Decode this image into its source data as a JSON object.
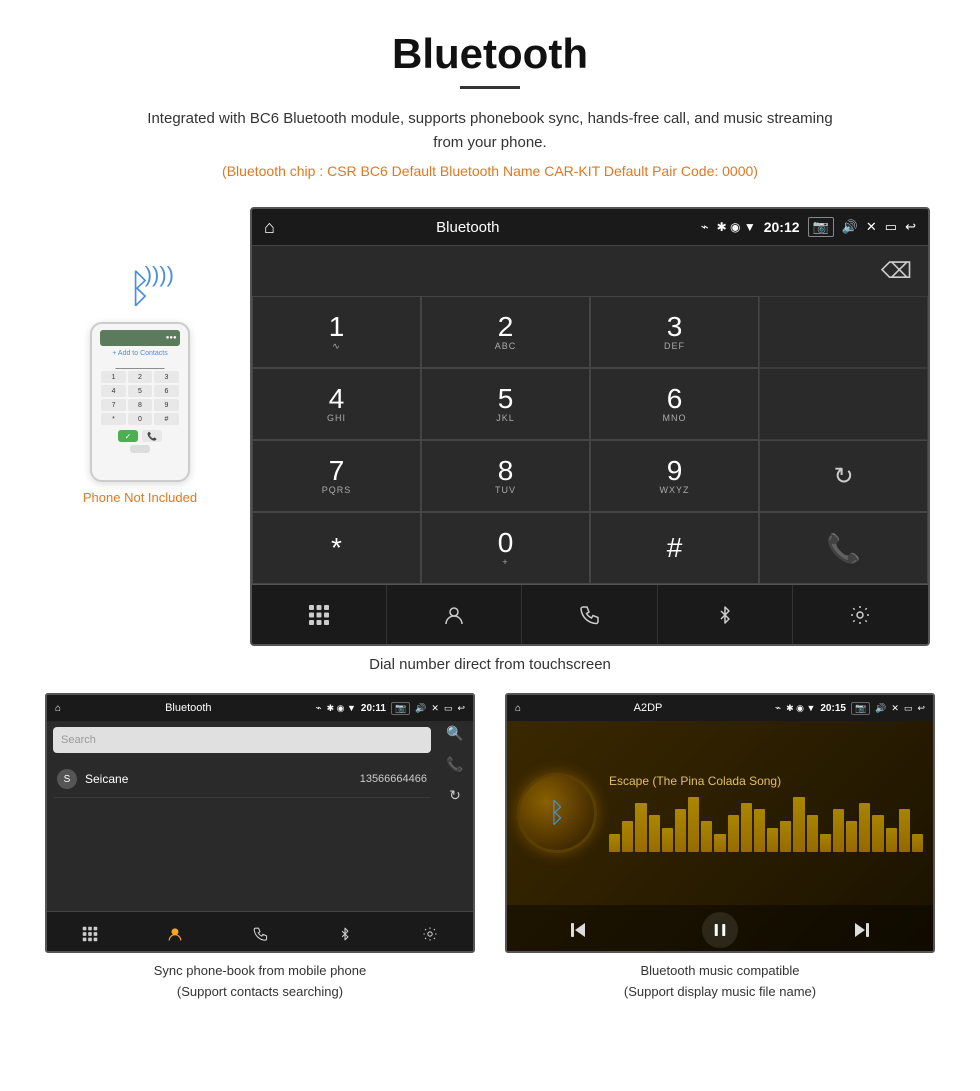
{
  "header": {
    "title": "Bluetooth",
    "subtitle": "Integrated with BC6 Bluetooth module, supports phonebook sync, hands-free call, and music streaming from your phone.",
    "specs": "(Bluetooth chip : CSR BC6    Default Bluetooth Name CAR-KIT    Default Pair Code: 0000)"
  },
  "phone_note": "Phone Not Included",
  "main_screen": {
    "statusbar": {
      "home_icon": "⌂",
      "title": "Bluetooth",
      "usb_icon": "⌁",
      "time": "20:12",
      "icons": "✱ ◉ ▼"
    },
    "dialpad": {
      "keys": [
        {
          "num": "1",
          "letters": "∿"
        },
        {
          "num": "2",
          "letters": "ABC"
        },
        {
          "num": "3",
          "letters": "DEF"
        },
        {
          "num": "4",
          "letters": "GHI"
        },
        {
          "num": "5",
          "letters": "JKL"
        },
        {
          "num": "6",
          "letters": "MNO"
        },
        {
          "num": "7",
          "letters": "PQRS"
        },
        {
          "num": "8",
          "letters": "TUV"
        },
        {
          "num": "9",
          "letters": "WXYZ"
        },
        {
          "num": "*",
          "letters": ""
        },
        {
          "num": "0",
          "letters": "+"
        },
        {
          "num": "#",
          "letters": ""
        }
      ]
    },
    "nav_icons": [
      "⊞",
      "👤",
      "📞",
      "✱",
      "🔗"
    ]
  },
  "caption_main": "Dial number direct from touchscreen",
  "phonebook_screen": {
    "statusbar": {
      "home_icon": "⌂",
      "title": "Bluetooth",
      "time": "20:11"
    },
    "search_placeholder": "Search",
    "contacts": [
      {
        "letter": "S",
        "name": "Seicane",
        "number": "13566664466"
      }
    ],
    "caption": "Sync phone-book from mobile phone\n(Support contacts searching)"
  },
  "music_screen": {
    "statusbar": {
      "home_icon": "⌂",
      "title": "A2DP",
      "time": "20:15"
    },
    "song_title": "Escape (The Pina Colada Song)",
    "visualizer_bars": [
      3,
      5,
      8,
      6,
      4,
      7,
      9,
      5,
      3,
      6,
      8,
      7,
      4,
      5,
      9,
      6,
      3,
      7,
      5,
      8,
      6,
      4,
      7,
      3
    ],
    "caption": "Bluetooth music compatible\n(Support display music file name)"
  },
  "icons": {
    "bluetooth": "₿",
    "phone": "📱",
    "call_green": "📞",
    "call_red": "📵",
    "backspace": "⌫",
    "refresh": "↻",
    "search": "🔍",
    "dialpad_grid": "⊞",
    "person": "👤",
    "phone_handset": "📞",
    "bt": "✱",
    "link": "🔗",
    "prev": "⏮",
    "play_pause": "⏯",
    "next": "⏭"
  }
}
